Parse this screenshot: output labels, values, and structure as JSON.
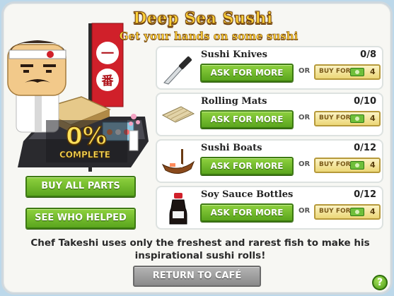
{
  "header": {
    "title": "Deep Sea Sushi",
    "subtitle": "Get your hands on some sushi"
  },
  "progress": {
    "percent_label": "0%",
    "complete_label": "COMPLETE",
    "value": 0
  },
  "banner": {
    "glyphs": "一番"
  },
  "actions": {
    "buy_all_label": "BUY ALL PARTS",
    "see_who_label": "SEE WHO HELPED"
  },
  "parts": [
    {
      "name": "Sushi Knives",
      "count": "0/8",
      "ask_label": "ASK FOR MORE",
      "or_label": "OR",
      "buy_label": "BUY FOR",
      "price": "4",
      "icon": "knife-icon"
    },
    {
      "name": "Rolling Mats",
      "count": "0/10",
      "ask_label": "ASK FOR MORE",
      "or_label": "OR",
      "buy_label": "BUY FOR",
      "price": "4",
      "icon": "rolling-mat-icon"
    },
    {
      "name": "Sushi Boats",
      "count": "0/12",
      "ask_label": "ASK FOR MORE",
      "or_label": "OR",
      "buy_label": "BUY FOR",
      "price": "4",
      "icon": "sushi-boat-icon"
    },
    {
      "name": "Soy Sauce Bottles",
      "count": "0/12",
      "ask_label": "ASK FOR MORE",
      "or_label": "OR",
      "buy_label": "BUY FOR",
      "price": "4",
      "icon": "soy-sauce-icon"
    }
  ],
  "description": "Chef Takeshi uses only the freshest and rarest fish to make his inspirational sushi rolls!",
  "footer": {
    "return_label": "RETURN TO CAFÉ",
    "help_label": "?"
  },
  "colors": {
    "title": "#ffd23a",
    "green_button": "#6fba2a",
    "buy_button": "#f2e39a",
    "return_button": "#9c9c9c"
  }
}
